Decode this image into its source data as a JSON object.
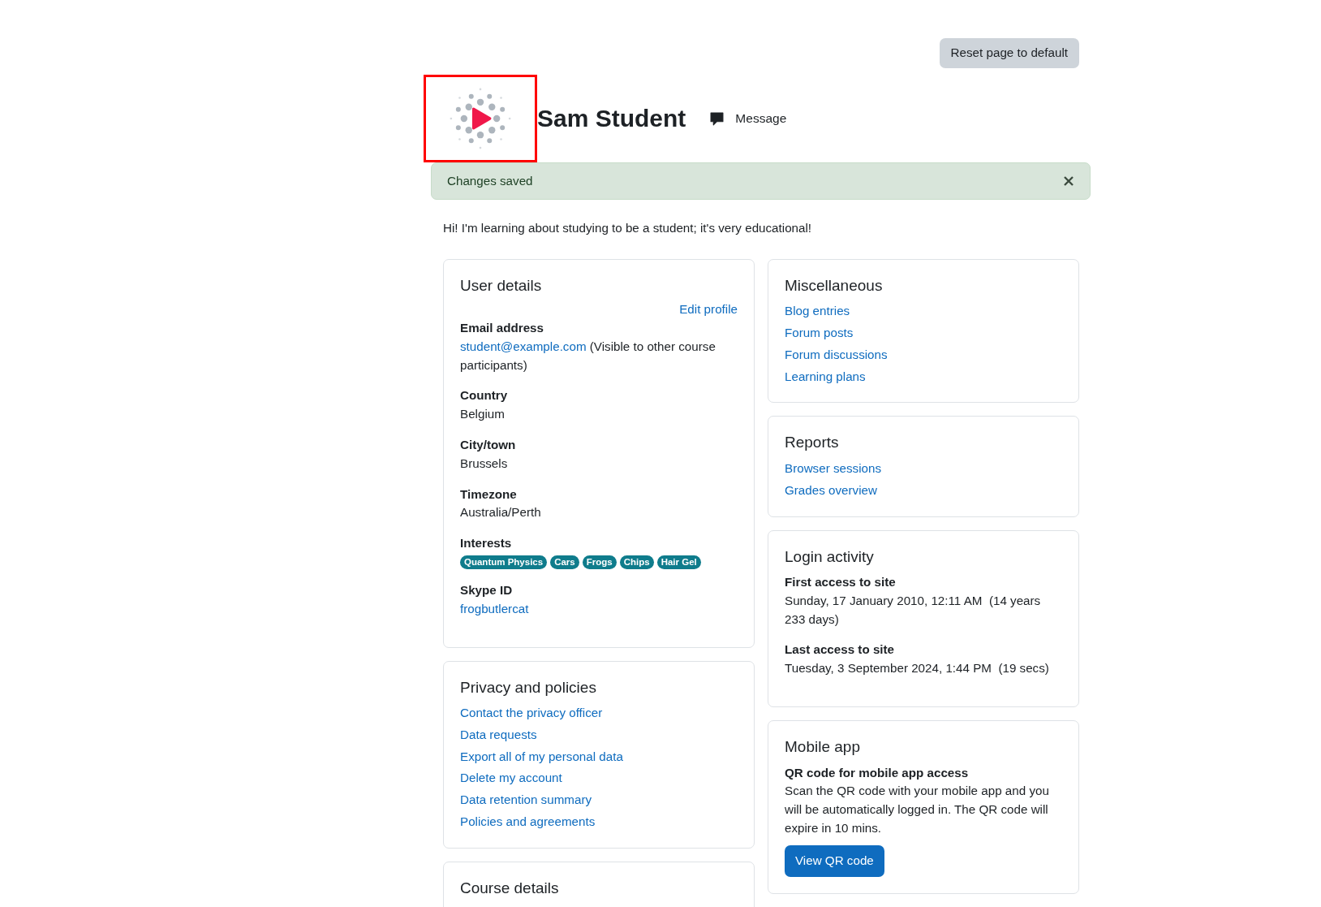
{
  "header": {
    "reset_button": "Reset page to default",
    "name": "Sam Student",
    "message_link": "Message"
  },
  "alert": {
    "text": "Changes saved",
    "dismissible": true
  },
  "description": "Hi! I'm learning about studying to be a student; it's very educational!",
  "columns": [
    [
      {
        "title": "User details",
        "edit_link": "Edit profile",
        "items": [
          {
            "kind": "email",
            "label": "Email address",
            "value": "student@example.com",
            "note": "(Visible to other course participants)"
          },
          {
            "kind": "field",
            "label": "Country",
            "value": "Belgium"
          },
          {
            "kind": "field",
            "label": "City/town",
            "value": "Brussels"
          },
          {
            "kind": "field",
            "label": "Timezone",
            "value": "Australia/Perth"
          },
          {
            "kind": "tags",
            "label": "Interests",
            "tags": [
              "Quantum Physics",
              "Cars",
              "Frogs",
              "Chips",
              "Hair Gel"
            ]
          },
          {
            "kind": "field_link",
            "label": "Skype ID",
            "value": "frogbutlercat"
          }
        ]
      },
      {
        "title": "Privacy and policies",
        "items": [
          {
            "kind": "link",
            "text": "Contact the privacy officer"
          },
          {
            "kind": "link",
            "text": "Data requests"
          },
          {
            "kind": "link",
            "text": "Export all of my personal data"
          },
          {
            "kind": "link",
            "text": "Delete my account"
          },
          {
            "kind": "link",
            "text": "Data retention summary"
          },
          {
            "kind": "link",
            "text": "Policies and agreements"
          }
        ]
      },
      {
        "title": "Course details"
      }
    ],
    [
      {
        "title": "Miscellaneous",
        "items": [
          {
            "kind": "link",
            "text": "Blog entries"
          },
          {
            "kind": "link",
            "text": "Forum posts"
          },
          {
            "kind": "link",
            "text": "Forum discussions"
          },
          {
            "kind": "link",
            "text": "Learning plans"
          }
        ]
      },
      {
        "title": "Reports",
        "items": [
          {
            "kind": "link",
            "text": "Browser sessions"
          },
          {
            "kind": "link",
            "text": "Grades overview"
          }
        ]
      },
      {
        "title": "Login activity",
        "items": [
          {
            "kind": "field",
            "label": "First access to site",
            "value": "Sunday, 17 January 2010, 12:11 AM  (14 years 233 days)"
          },
          {
            "kind": "field",
            "label": "Last access to site",
            "value": "Tuesday, 3 September 2024, 1:44 PM  (19 secs)"
          }
        ]
      },
      {
        "title": "Mobile app",
        "items": [
          {
            "kind": "text_block",
            "label": "QR code for mobile app access",
            "text": "Scan the QR code with your mobile app and you will be automatically logged in. The QR code will expire in 10 mins."
          },
          {
            "kind": "button",
            "text": "View QR code"
          }
        ]
      }
    ]
  ]
}
